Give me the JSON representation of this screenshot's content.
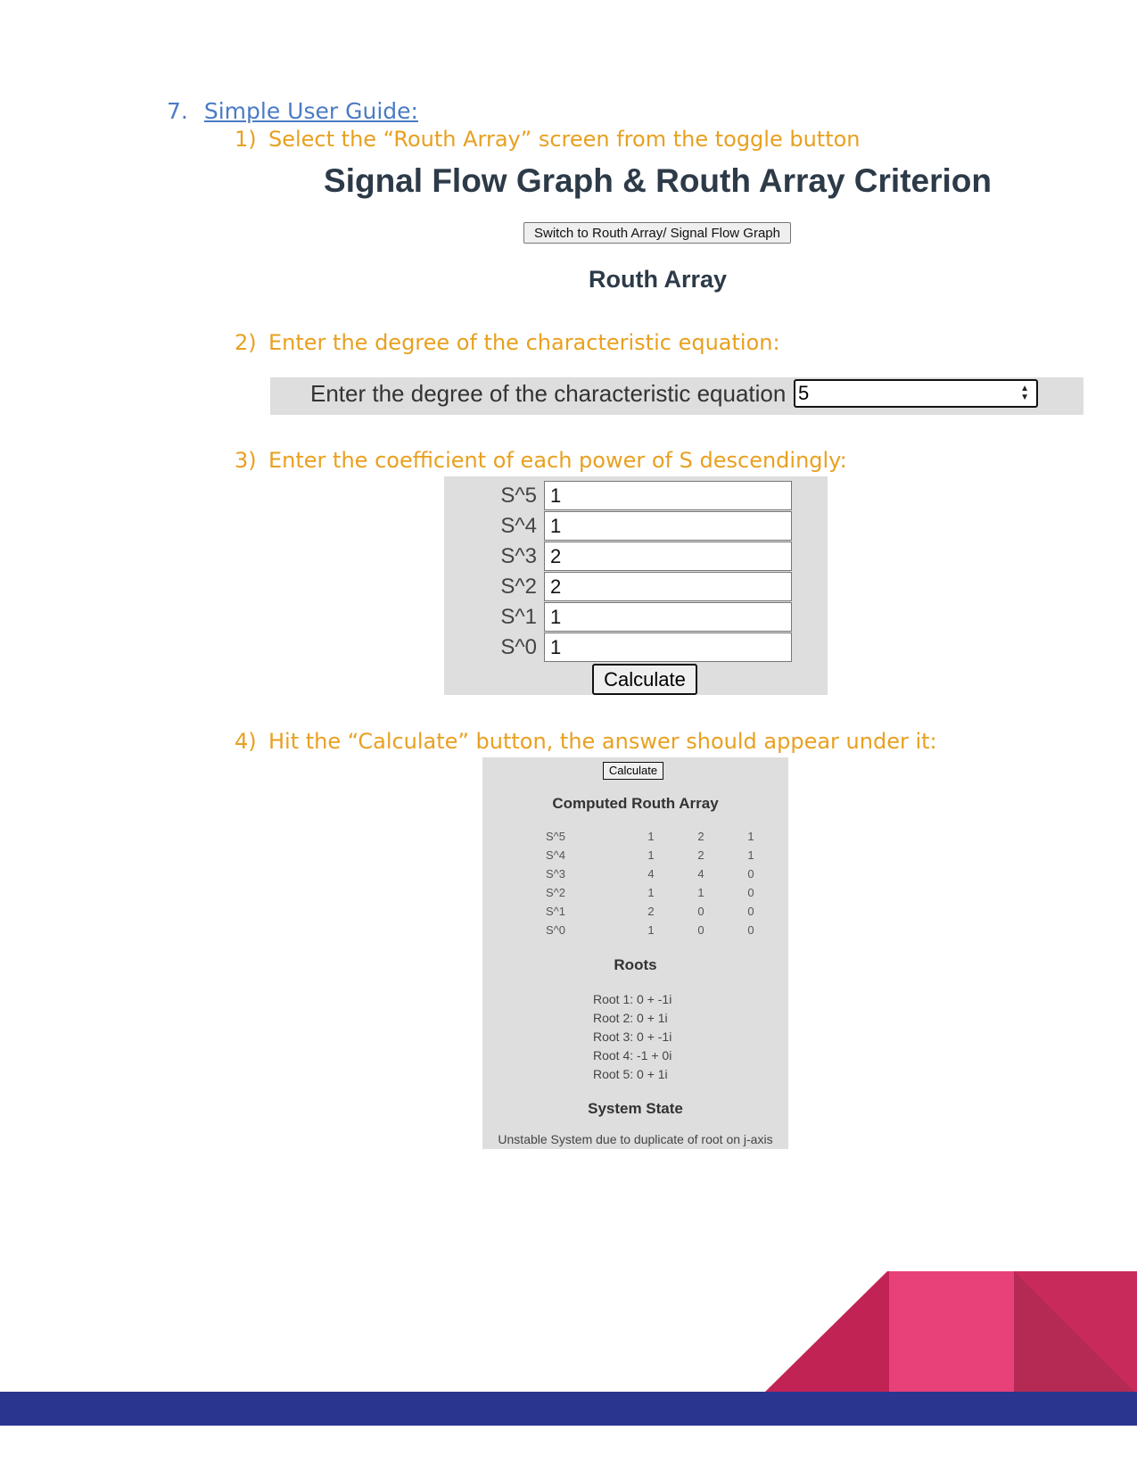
{
  "guide": {
    "number": "7.",
    "title": "Simple User Guide:"
  },
  "steps": [
    {
      "num": "1)",
      "text": "Select the “Routh Array” screen from the toggle button"
    },
    {
      "num": "2)",
      "text": "Enter the degree of the characteristic equation:"
    },
    {
      "num": "3)",
      "text": "Enter the coefficient of each power of S descendingly:"
    },
    {
      "num": "4)",
      "text": "Hit the “Calculate” button, the answer should appear under it:"
    }
  ],
  "app": {
    "title": "Signal Flow Graph & Routh Array Criterion",
    "toggle_button": "Switch to Routh Array/ Signal Flow Graph",
    "panel_title": "Routh Array"
  },
  "degree": {
    "label": "Enter the degree of the characteristic equation",
    "value": "5"
  },
  "coefficients": [
    {
      "label": "S^5",
      "value": "1"
    },
    {
      "label": "S^4",
      "value": "1"
    },
    {
      "label": "S^3",
      "value": "2"
    },
    {
      "label": "S^2",
      "value": "2"
    },
    {
      "label": "S^1",
      "value": "1"
    },
    {
      "label": "S^0",
      "value": "1"
    }
  ],
  "calculate_label": "Calculate",
  "results": {
    "calculate_label": "Calculate",
    "routh_title": "Computed Routh Array",
    "routh_rows": [
      {
        "label": "S^5",
        "values": [
          "1",
          "2",
          "1"
        ]
      },
      {
        "label": "S^4",
        "values": [
          "1",
          "2",
          "1"
        ]
      },
      {
        "label": "S^3",
        "values": [
          "4",
          "4",
          "0"
        ]
      },
      {
        "label": "S^2",
        "values": [
          "1",
          "1",
          "0"
        ]
      },
      {
        "label": "S^1",
        "values": [
          "2",
          "0",
          "0"
        ]
      },
      {
        "label": "S^0",
        "values": [
          "1",
          "0",
          "0"
        ]
      }
    ],
    "roots_title": "Roots",
    "roots": [
      "Root 1: 0 + -1i",
      "Root 2: 0 + 1i",
      "Root 3: 0 + -1i",
      "Root 4: -1 + 0i",
      "Root 5: 0 + 1i"
    ],
    "state_title": "System State",
    "state_text": "Unstable System due to duplicate of root on j-axis"
  },
  "colors": {
    "link": "#4a7bc4",
    "step_text": "#e8a020",
    "heading": "#2d3a48",
    "panel_gray": "#dedede",
    "footer_navy": "#2a3590",
    "accent_pink": "#e8417a",
    "accent_crimson": "#c22355"
  }
}
